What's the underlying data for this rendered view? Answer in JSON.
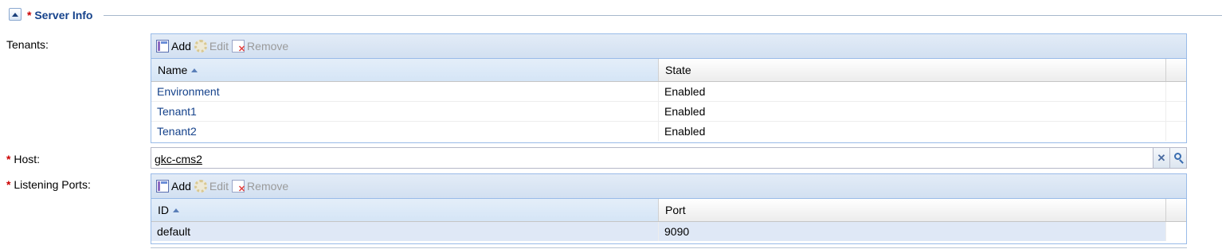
{
  "section": {
    "title": "Server Info",
    "required_mark": "*"
  },
  "tenants": {
    "label": "Tenants:",
    "toolbar": {
      "add": "Add",
      "edit": "Edit",
      "remove": "Remove"
    },
    "columns": [
      "Name",
      "State"
    ],
    "rows": [
      {
        "name": "Environment",
        "state": "Enabled"
      },
      {
        "name": "Tenant1",
        "state": "Enabled"
      },
      {
        "name": "Tenant2",
        "state": "Enabled"
      }
    ]
  },
  "host": {
    "label": "Host:",
    "required_mark": "*",
    "value": "gkc-cms2",
    "clear_glyph": "✕"
  },
  "ports": {
    "label": "Listening Ports:",
    "required_mark": "*",
    "toolbar": {
      "add": "Add",
      "edit": "Edit",
      "remove": "Remove"
    },
    "columns": [
      "ID",
      "Port"
    ],
    "rows": [
      {
        "id": "default",
        "port": "9090"
      }
    ]
  }
}
